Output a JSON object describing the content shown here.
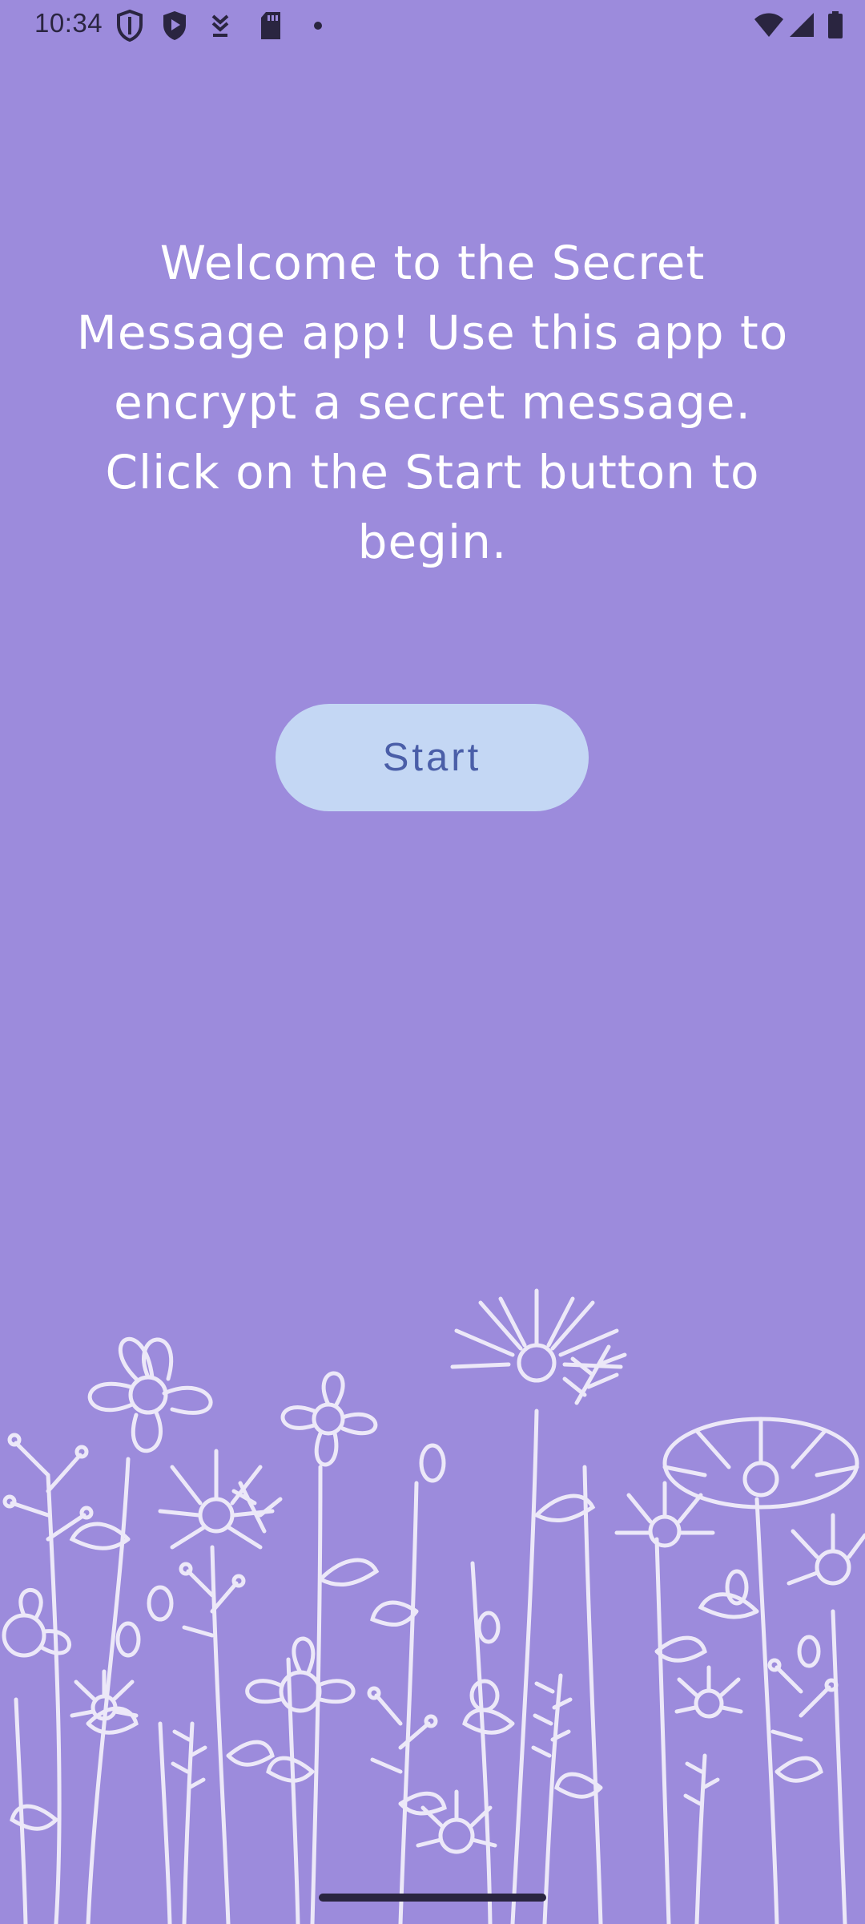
{
  "status_bar": {
    "time": "10:34",
    "left_icons": [
      "shield-outline-icon",
      "shield-play-icon",
      "download-arrow-icon",
      "sd-card-icon",
      "dot-icon"
    ],
    "right_icons": [
      "wifi-icon",
      "signal-icon",
      "battery-icon"
    ]
  },
  "welcome": {
    "message": "Welcome to the Secret Message app! Use this app to encrypt a secret message. Click on the Start button to begin."
  },
  "start_button": {
    "label": "Start"
  },
  "theme": {
    "background": "#9c8bdc",
    "button_bg": "#c4d7f4",
    "button_text": "#4a5ea8",
    "text": "#ffffff",
    "illustration": "#ece8f8"
  }
}
